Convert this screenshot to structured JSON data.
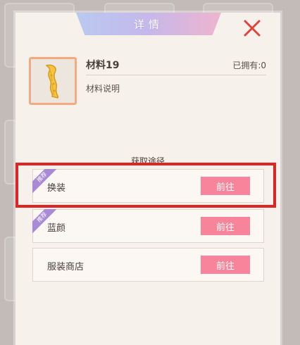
{
  "dialog": {
    "title": "详情",
    "close_icon": "close-icon"
  },
  "item": {
    "name": "材料19",
    "owned": "已拥有:0",
    "description": "材料说明",
    "icon": "ribbon-scroll-icon"
  },
  "sources": {
    "title": "获取途径",
    "rows": [
      {
        "label": "换装",
        "button": "前往",
        "tag": "推荐"
      },
      {
        "label": "蓝颜",
        "button": "前往",
        "tag": "推荐"
      },
      {
        "label": "服装商店",
        "button": "前往",
        "tag": ""
      }
    ]
  },
  "colors": {
    "panel_bg": "#f6f1ea",
    "go_button": "#f8849b",
    "tag": "#a98ad6",
    "item_border": "#f6a87e",
    "highlight": "#e02424",
    "close": "#e0443e"
  }
}
